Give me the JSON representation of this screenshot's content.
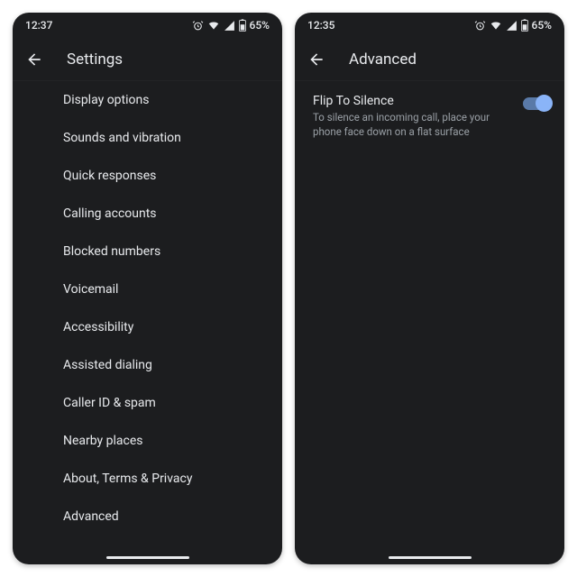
{
  "left": {
    "status": {
      "time": "12:37",
      "battery": "65%"
    },
    "title": "Settings",
    "items": [
      "Display options",
      "Sounds and vibration",
      "Quick responses",
      "Calling accounts",
      "Blocked numbers",
      "Voicemail",
      "Accessibility",
      "Assisted dialing",
      "Caller ID & spam",
      "Nearby places",
      "About, Terms & Privacy",
      "Advanced"
    ]
  },
  "right": {
    "status": {
      "time": "12:35",
      "battery": "65%"
    },
    "title": "Advanced",
    "setting": {
      "title": "Flip To Silence",
      "sub": "To silence an incoming call, place your phone face down on a flat surface",
      "enabled": true
    }
  }
}
